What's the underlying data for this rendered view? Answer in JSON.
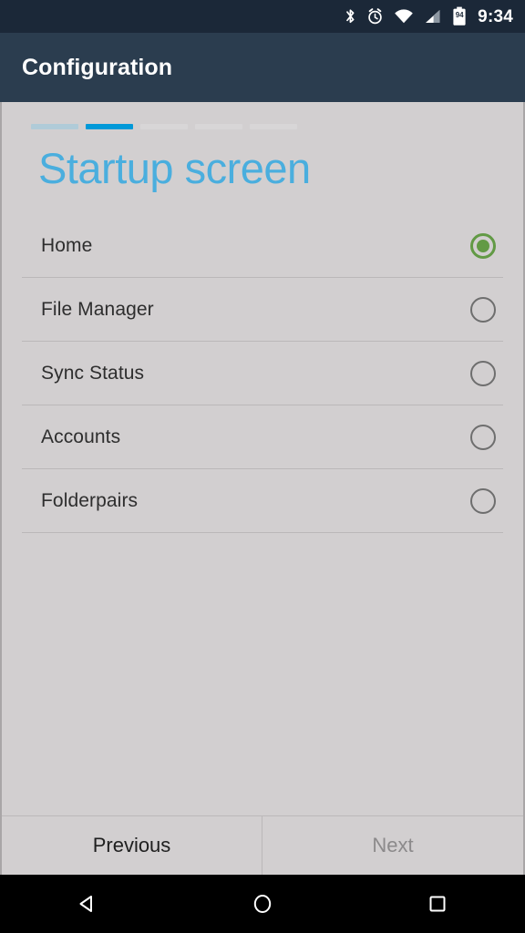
{
  "status_bar": {
    "icons": [
      "bluetooth-icon",
      "alarm-icon",
      "wifi-icon",
      "cellular-signal-icon",
      "battery-icon"
    ],
    "battery_level": "94",
    "time": "9:34",
    "background_color": "#1b2838"
  },
  "app_bar": {
    "title": "Configuration",
    "background_color": "#2b3d4f",
    "text_color": "#ffffff"
  },
  "wizard": {
    "total_steps": 5,
    "current_step": 2,
    "step_states": [
      "done",
      "active",
      "pending",
      "pending",
      "pending"
    ],
    "colors": {
      "done": "#b0cbd8",
      "active": "#0099d8",
      "pending": "#d8d6d7"
    }
  },
  "page": {
    "title": "Startup screen",
    "title_color": "#4aaede",
    "background_color": "#d2cfd0"
  },
  "options": {
    "selected_index": 0,
    "selected_color": "#629a45",
    "unselected_color": "#6e6e6e",
    "items": [
      {
        "label": "Home",
        "selected": true
      },
      {
        "label": "File Manager",
        "selected": false
      },
      {
        "label": "Sync Status",
        "selected": false
      },
      {
        "label": "Accounts",
        "selected": false
      },
      {
        "label": "Folderpairs",
        "selected": false
      }
    ]
  },
  "footer": {
    "previous_label": "Previous",
    "next_label": "Next",
    "previous_color": "#1f1f1f",
    "next_color": "#8c8a8b"
  },
  "nav_bar": {
    "back": "back-triangle-icon",
    "home": "home-circle-icon",
    "recents": "recents-square-icon",
    "background_color": "#000000"
  }
}
